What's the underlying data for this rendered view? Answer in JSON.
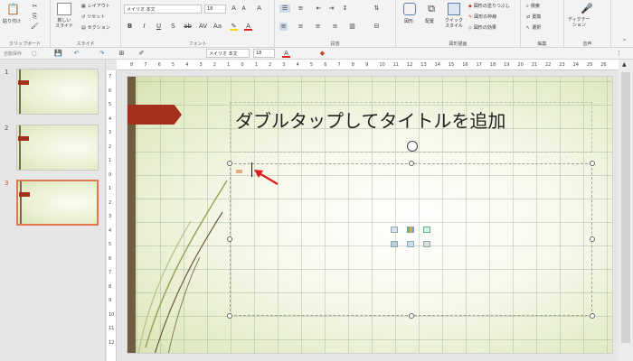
{
  "ribbon": {
    "clipboard": {
      "paste": "貼り付け",
      "label": "クリップボード"
    },
    "slides": {
      "new_slide": "新しい\nスライド",
      "layout": "レイアウト",
      "reset": "リセット",
      "section": "セクション",
      "label": "スライド"
    },
    "font": {
      "family": "メイリオ 本文",
      "size": "18",
      "label": "フォント"
    },
    "paragraph": {
      "label": "段落"
    },
    "drawing": {
      "shapes": "図形",
      "arrange": "配置",
      "quick_styles": "クイック\nスタイル",
      "fill": "図形の塗りつぶし",
      "outline": "図形の枠線",
      "effects": "図形の効果",
      "label": "図形描画"
    },
    "editing": {
      "find": "検索",
      "replace": "置換",
      "select": "選択",
      "label": "編集"
    },
    "voice": {
      "dictate": "ディクテー\nション",
      "label": "音声"
    }
  },
  "qat": {
    "autosave": "自動保存",
    "font_family": "メイリオ 本文",
    "font_size": "18"
  },
  "thumbnails": [
    {
      "num": "1"
    },
    {
      "num": "2"
    },
    {
      "num": "3"
    }
  ],
  "hruler": [
    "8",
    "7",
    "6",
    "5",
    "4",
    "3",
    "2",
    "1",
    "0",
    "1",
    "2",
    "3",
    "4",
    "5",
    "6",
    "7",
    "8",
    "9",
    "10",
    "11",
    "12",
    "13",
    "14",
    "15",
    "16",
    "17",
    "18",
    "19",
    "20",
    "21",
    "22",
    "23",
    "24",
    "25",
    "26"
  ],
  "vruler": [
    "7",
    "6",
    "5",
    "4",
    "3",
    "2",
    "1",
    "0",
    "1",
    "2",
    "3",
    "4",
    "5",
    "6",
    "7",
    "8",
    "9",
    "10",
    "11",
    "12"
  ],
  "slide": {
    "title": "ダブルタップしてタイトルを追加"
  },
  "colors": {
    "accent": "#a3301c",
    "arrow": "#e01b1b",
    "selected": "#e2764f"
  }
}
